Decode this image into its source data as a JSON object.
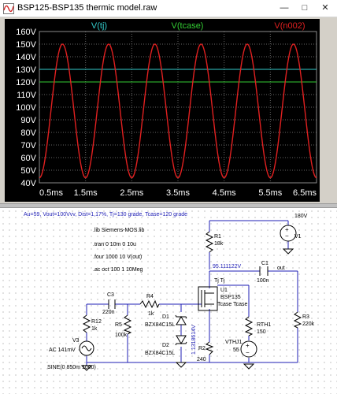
{
  "window": {
    "title": "BSP125-BSP135 thermic model.raw",
    "icon": "waveform-icon",
    "buttons": [
      "minimize",
      "maximize",
      "close"
    ]
  },
  "plot": {
    "background": "#000000",
    "grid_color": "#666666",
    "traces": [
      {
        "label": "V(tj)",
        "color": "#33cccc"
      },
      {
        "label": "V(tcase)",
        "color": "#33cc33"
      },
      {
        "label": "V(n002)",
        "color": "#e02020"
      }
    ],
    "y_ticks": [
      "160V",
      "150V",
      "140V",
      "130V",
      "120V",
      "110V",
      "100V",
      "90V",
      "80V",
      "70V",
      "60V",
      "50V",
      "40V"
    ],
    "x_ticks": [
      "0.5ms",
      "1.5ms",
      "2.5ms",
      "3.5ms",
      "4.5ms",
      "5.5ms",
      "6.5ms"
    ]
  },
  "chart_data": {
    "type": "line",
    "title": "",
    "xlabel": "",
    "ylabel": "",
    "xlim": [
      0.5,
      6.5
    ],
    "ylim": [
      40,
      160
    ],
    "grid": true,
    "legend": "top",
    "series": [
      {
        "name": "V(tj)",
        "kind": "constant",
        "value": 130
      },
      {
        "name": "V(tcase)",
        "kind": "constant",
        "value": 120
      },
      {
        "name": "V(n002)",
        "kind": "sine",
        "offset": 97,
        "amplitude": 53,
        "frequency_per_ms": 1,
        "peak_times_ms": [
          1.0,
          2.0,
          3.0,
          4.0,
          5.0,
          6.0
        ]
      }
    ]
  },
  "schematic": {
    "header_note": "Au=59, Vout=100Vvv, Dist=1,17%, Tj=130 grade, Tcase=120 grade",
    "directives": [
      ".lib Siemens-MOS.lib",
      ".tran 0 10m 0 10u",
      ".four 1000 10 V(out)",
      ".ac oct 100 1 10Meg"
    ],
    "v1": {
      "name": "V1",
      "value": "180V"
    },
    "r1": {
      "name": "R1",
      "value": "18k"
    },
    "node_voltage": "95.111122V",
    "c1": {
      "name": "C1",
      "value": "100n"
    },
    "out_label": "out",
    "u1": {
      "name": "U1",
      "part": "BSP135",
      "pins_top": "Tj  Tj",
      "pins_bottom": "Tcase Tcase"
    },
    "r3": {
      "name": "R3",
      "value": "220k"
    },
    "c3": {
      "name": "C3",
      "value": "220n"
    },
    "r4": {
      "name": "R4",
      "value": "1k"
    },
    "r12": {
      "name": "R12",
      "value": "1k"
    },
    "r5": {
      "name": "R5",
      "value": "100k"
    },
    "d1": {
      "name": "D1",
      "part": "BZX84C15L"
    },
    "d2": {
      "name": "D2",
      "part": "BZX84C15L"
    },
    "gate_voltage": "1.1318614V",
    "r2": {
      "name": "R2",
      "value": "240"
    },
    "rth1": {
      "name": "RTH1",
      "value": "150"
    },
    "vthj1": {
      "name": "VTHJ1",
      "value": "55"
    },
    "v3": {
      "name": "V3",
      "value": "AC 141mV",
      "source": "SINE(0 850m 1000)"
    }
  }
}
